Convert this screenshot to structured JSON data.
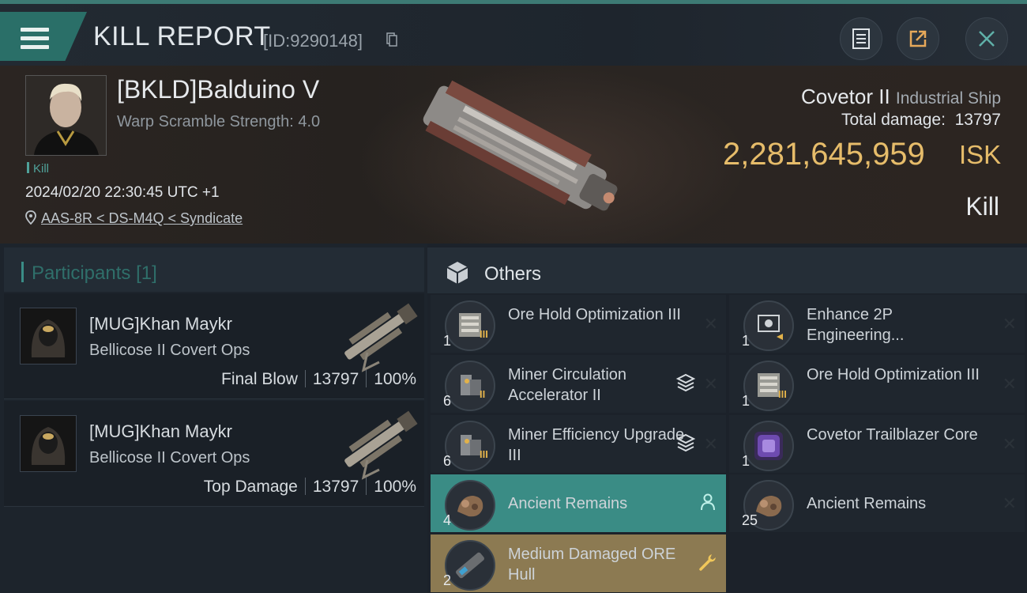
{
  "header": {
    "title": "KILL REPORT",
    "report_id": "[ID:9290148]"
  },
  "victim": {
    "name": "[BKLD]Balduino V",
    "warp_scramble": "Warp Scramble Strength: 4.0",
    "tag": "Kill",
    "datetime": "2024/02/20 22:30:45 UTC +1",
    "location": "AAS-8R < DS-M4Q < Syndicate",
    "ship_name": "Covetor II",
    "ship_class": "Industrial Ship",
    "total_damage_label": "Total damage:",
    "total_damage": "13797",
    "isk_value": "2,281,645,959",
    "isk_unit": "ISK",
    "result": "Kill"
  },
  "participants": {
    "label": "Participants",
    "count": "[1]",
    "rows": [
      {
        "name": "[MUG]Khan Maykr",
        "ship": "Bellicose II Covert Ops",
        "role": "Final Blow",
        "damage": "13797",
        "percent": "100%"
      },
      {
        "name": "[MUG]Khan Maykr",
        "ship": "Bellicose II Covert Ops",
        "role": "Top Damage",
        "damage": "13797",
        "percent": "100%"
      }
    ]
  },
  "others": {
    "label": "Others",
    "items": [
      {
        "name": "Ore Hold Optimization III",
        "qty": "1",
        "icon": "module-cargo-icon",
        "status": "destroyed"
      },
      {
        "name": "Enhance 2P Engineering...",
        "qty": "1",
        "icon": "chip-icon",
        "status": "destroyed"
      },
      {
        "name": "Miner Circulation Accelerator II",
        "qty": "6",
        "icon": "module-miner-icon",
        "status": "destroyed",
        "stacked": true
      },
      {
        "name": "Ore Hold Optimization III",
        "qty": "1",
        "icon": "module-cargo-icon",
        "status": "destroyed"
      },
      {
        "name": "Miner Efficiency Upgrade III",
        "qty": "6",
        "icon": "module-miner-icon",
        "status": "destroyed",
        "stacked": true
      },
      {
        "name": "Covetor Trailblazer Core",
        "qty": "1",
        "icon": "core-icon",
        "status": "destroyed"
      },
      {
        "name": "Ancient Remains",
        "qty": "4",
        "icon": "remains-icon",
        "status": "dropped-to-pilot"
      },
      {
        "name": "Ancient Remains",
        "qty": "25",
        "icon": "remains-icon",
        "status": "destroyed"
      },
      {
        "name": "Medium Damaged ORE Hull",
        "qty": "2",
        "icon": "hull-icon",
        "status": "salvage"
      }
    ]
  },
  "colors": {
    "accent_teal": "#3a8c85",
    "isk_gold": "#e6bc6a",
    "salvage_gold": "#8c7a52"
  }
}
